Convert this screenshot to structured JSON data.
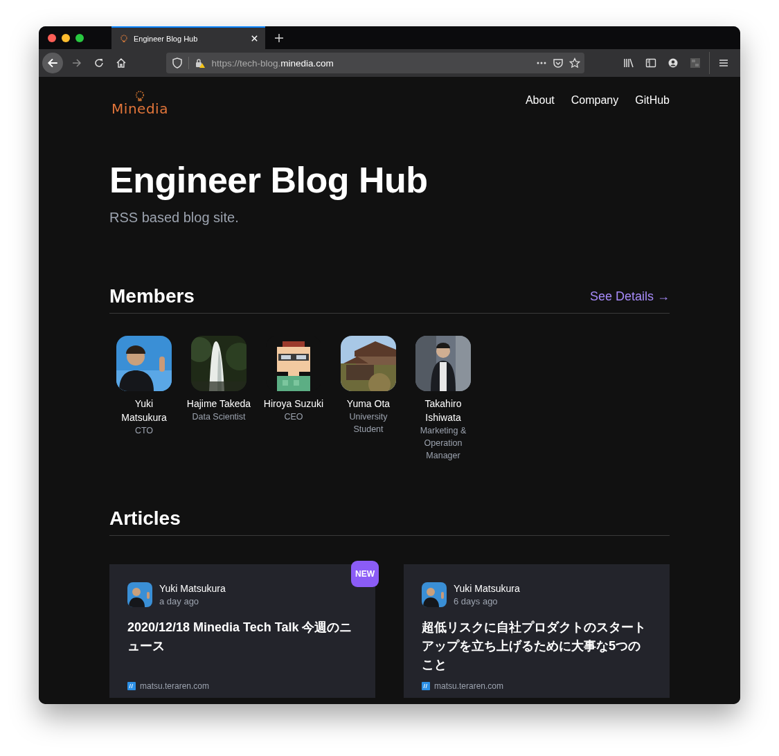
{
  "browser": {
    "tab_title": "Engineer Blog Hub",
    "url_prefix": "https://tech-blog.",
    "url_domain": "minedia.com"
  },
  "header": {
    "logo": "Minedia",
    "nav": [
      "About",
      "Company",
      "GitHub"
    ]
  },
  "hero": {
    "title": "Engineer Blog Hub",
    "subtitle": "RSS based blog site."
  },
  "members": {
    "heading": "Members",
    "link": "See Details →",
    "items": [
      {
        "name": "Yuki Matsukura",
        "role": "CTO"
      },
      {
        "name": "Hajime Takeda",
        "role": "Data Scientist"
      },
      {
        "name": "Hiroya Suzuki",
        "role": "CEO"
      },
      {
        "name": "Yuma Ota",
        "role": "University Student"
      },
      {
        "name": "Takahiro Ishiwata",
        "role": "Marketing & Operation Manager"
      }
    ]
  },
  "articles": {
    "heading": "Articles",
    "items": [
      {
        "author": "Yuki Matsukura",
        "time": "a day ago",
        "title": "2020/12/18 Minedia Tech Talk 今週のニュース",
        "source": "matsu.teraren.com",
        "new": true,
        "badge": "NEW"
      },
      {
        "author": "Yuki Matsukura",
        "time": "6 days ago",
        "title": "超低リスクに自社プロダクトのスタートアップを立ち上げるために大事な5つのこと",
        "source": "matsu.teraren.com",
        "new": false
      }
    ]
  }
}
